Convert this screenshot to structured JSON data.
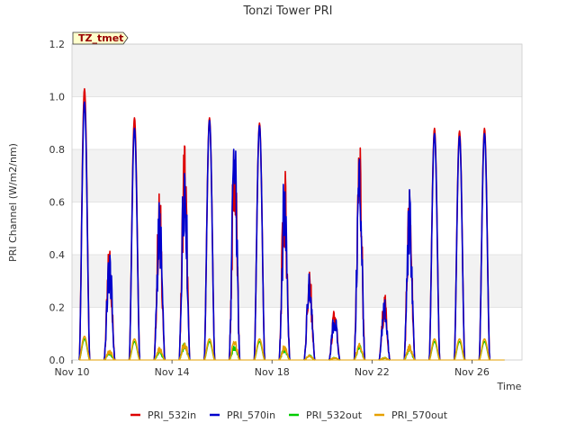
{
  "chart_data": {
    "type": "line",
    "title": "Tonzi Tower PRI",
    "xlabel": "Time",
    "ylabel": "PRI Channel (W/m2/nm)",
    "site_tag": "TZ_tmet",
    "ylim": [
      0.0,
      1.2
    ],
    "xlim": [
      "2023-11-10",
      "2023-11-28"
    ],
    "yticks": [
      "0.0",
      "0.2",
      "0.4",
      "0.6",
      "0.8",
      "1.0",
      "1.2"
    ],
    "xticks": [
      "Nov 10",
      "Nov 14",
      "Nov 18",
      "Nov 22",
      "Nov 26"
    ],
    "grid": true,
    "legend_position": "bottom",
    "days": [
      "Nov 10",
      "Nov 11",
      "Nov 12",
      "Nov 13",
      "Nov 14",
      "Nov 15",
      "Nov 16",
      "Nov 17",
      "Nov 18",
      "Nov 19",
      "Nov 20",
      "Nov 21",
      "Nov 22",
      "Nov 23",
      "Nov 24",
      "Nov 25",
      "Nov 26",
      "Nov 27"
    ],
    "series": [
      {
        "name": "PRI_532in",
        "color": "#dd0000",
        "daily_peak": [
          1.03,
          0.46,
          0.92,
          0.67,
          0.89,
          0.92,
          0.92,
          0.9,
          0.76,
          0.35,
          0.2,
          0.89,
          0.26,
          0.68,
          0.88,
          0.87,
          0.88,
          0.0
        ]
      },
      {
        "name": "PRI_570in",
        "color": "#0000cc",
        "daily_peak": [
          0.98,
          0.44,
          0.88,
          0.63,
          0.89,
          0.91,
          0.92,
          0.89,
          0.75,
          0.35,
          0.19,
          0.85,
          0.25,
          0.66,
          0.86,
          0.85,
          0.86,
          0.0
        ]
      },
      {
        "name": "PRI_532out",
        "color": "#00cc00",
        "daily_peak": [
          0.08,
          0.03,
          0.07,
          0.04,
          0.07,
          0.07,
          0.06,
          0.07,
          0.05,
          0.02,
          0.01,
          0.06,
          0.01,
          0.05,
          0.07,
          0.07,
          0.07,
          0.0
        ]
      },
      {
        "name": "PRI_570out",
        "color": "#e6a000",
        "daily_peak": [
          0.09,
          0.04,
          0.08,
          0.05,
          0.08,
          0.08,
          0.08,
          0.08,
          0.06,
          0.02,
          0.01,
          0.07,
          0.01,
          0.06,
          0.08,
          0.08,
          0.08,
          0.0
        ]
      }
    ]
  }
}
